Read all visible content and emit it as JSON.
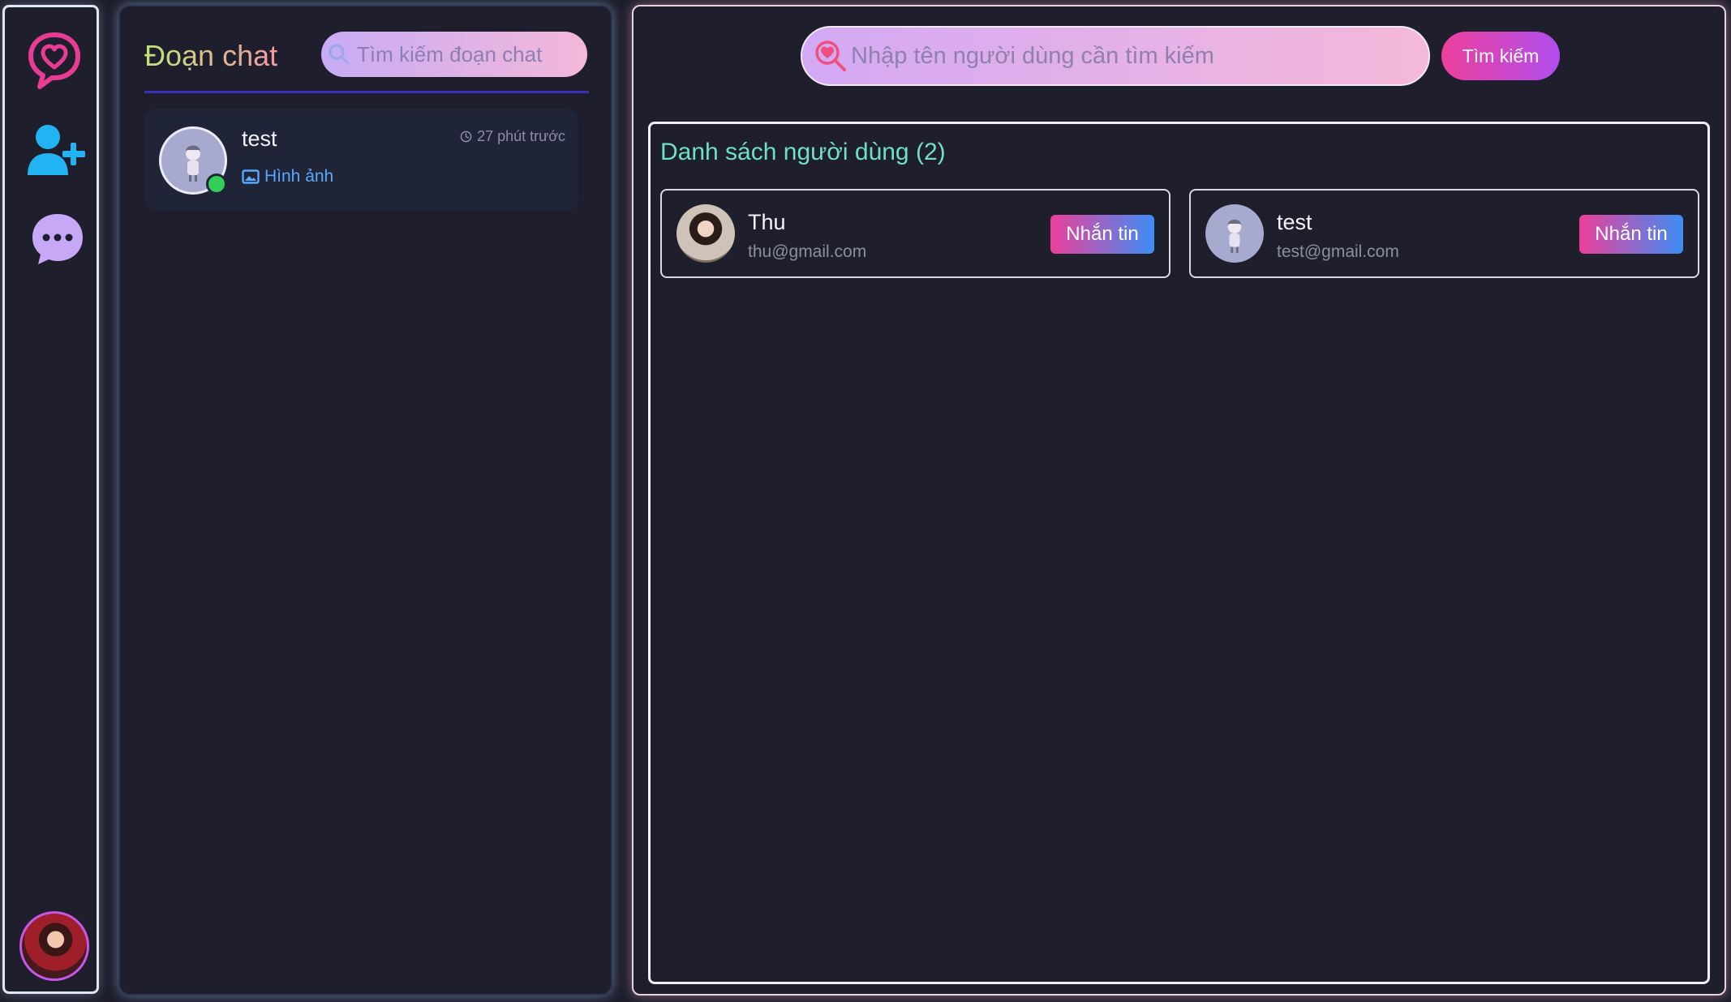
{
  "sidebar": {
    "logo_icon": "heart-chat-icon",
    "items": [
      {
        "name": "add-user",
        "icon": "user-plus-icon"
      },
      {
        "name": "more",
        "icon": "more-chat-icon"
      }
    ],
    "colors": {
      "logo": "#e83b93",
      "add_user": "#22b3f2",
      "more": "#c6a8f7"
    }
  },
  "conversations": {
    "title": "Đoạn chat",
    "search_placeholder": "Tìm kiếm đoạn chat",
    "items": [
      {
        "name": "test",
        "time": "27 phút trước",
        "preview": "Hình ảnh",
        "online": true
      }
    ]
  },
  "main": {
    "search_placeholder": "Nhập tên người dùng cần tìm kiếm",
    "search_button": "Tìm kiếm",
    "user_list_title": "Danh sách người dùng (2)",
    "users": [
      {
        "name": "Thu",
        "email": "thu@gmail.com",
        "action": "Nhắn tin"
      },
      {
        "name": "test",
        "email": "test@gmail.com",
        "action": "Nhắn tin"
      }
    ]
  },
  "colors": {
    "background": "#1e1e2d",
    "accent_pink": "#ec3f9b",
    "accent_blue": "#3d8ef5",
    "online": "#2fcf58",
    "heading_green": "#6fe0c4"
  }
}
